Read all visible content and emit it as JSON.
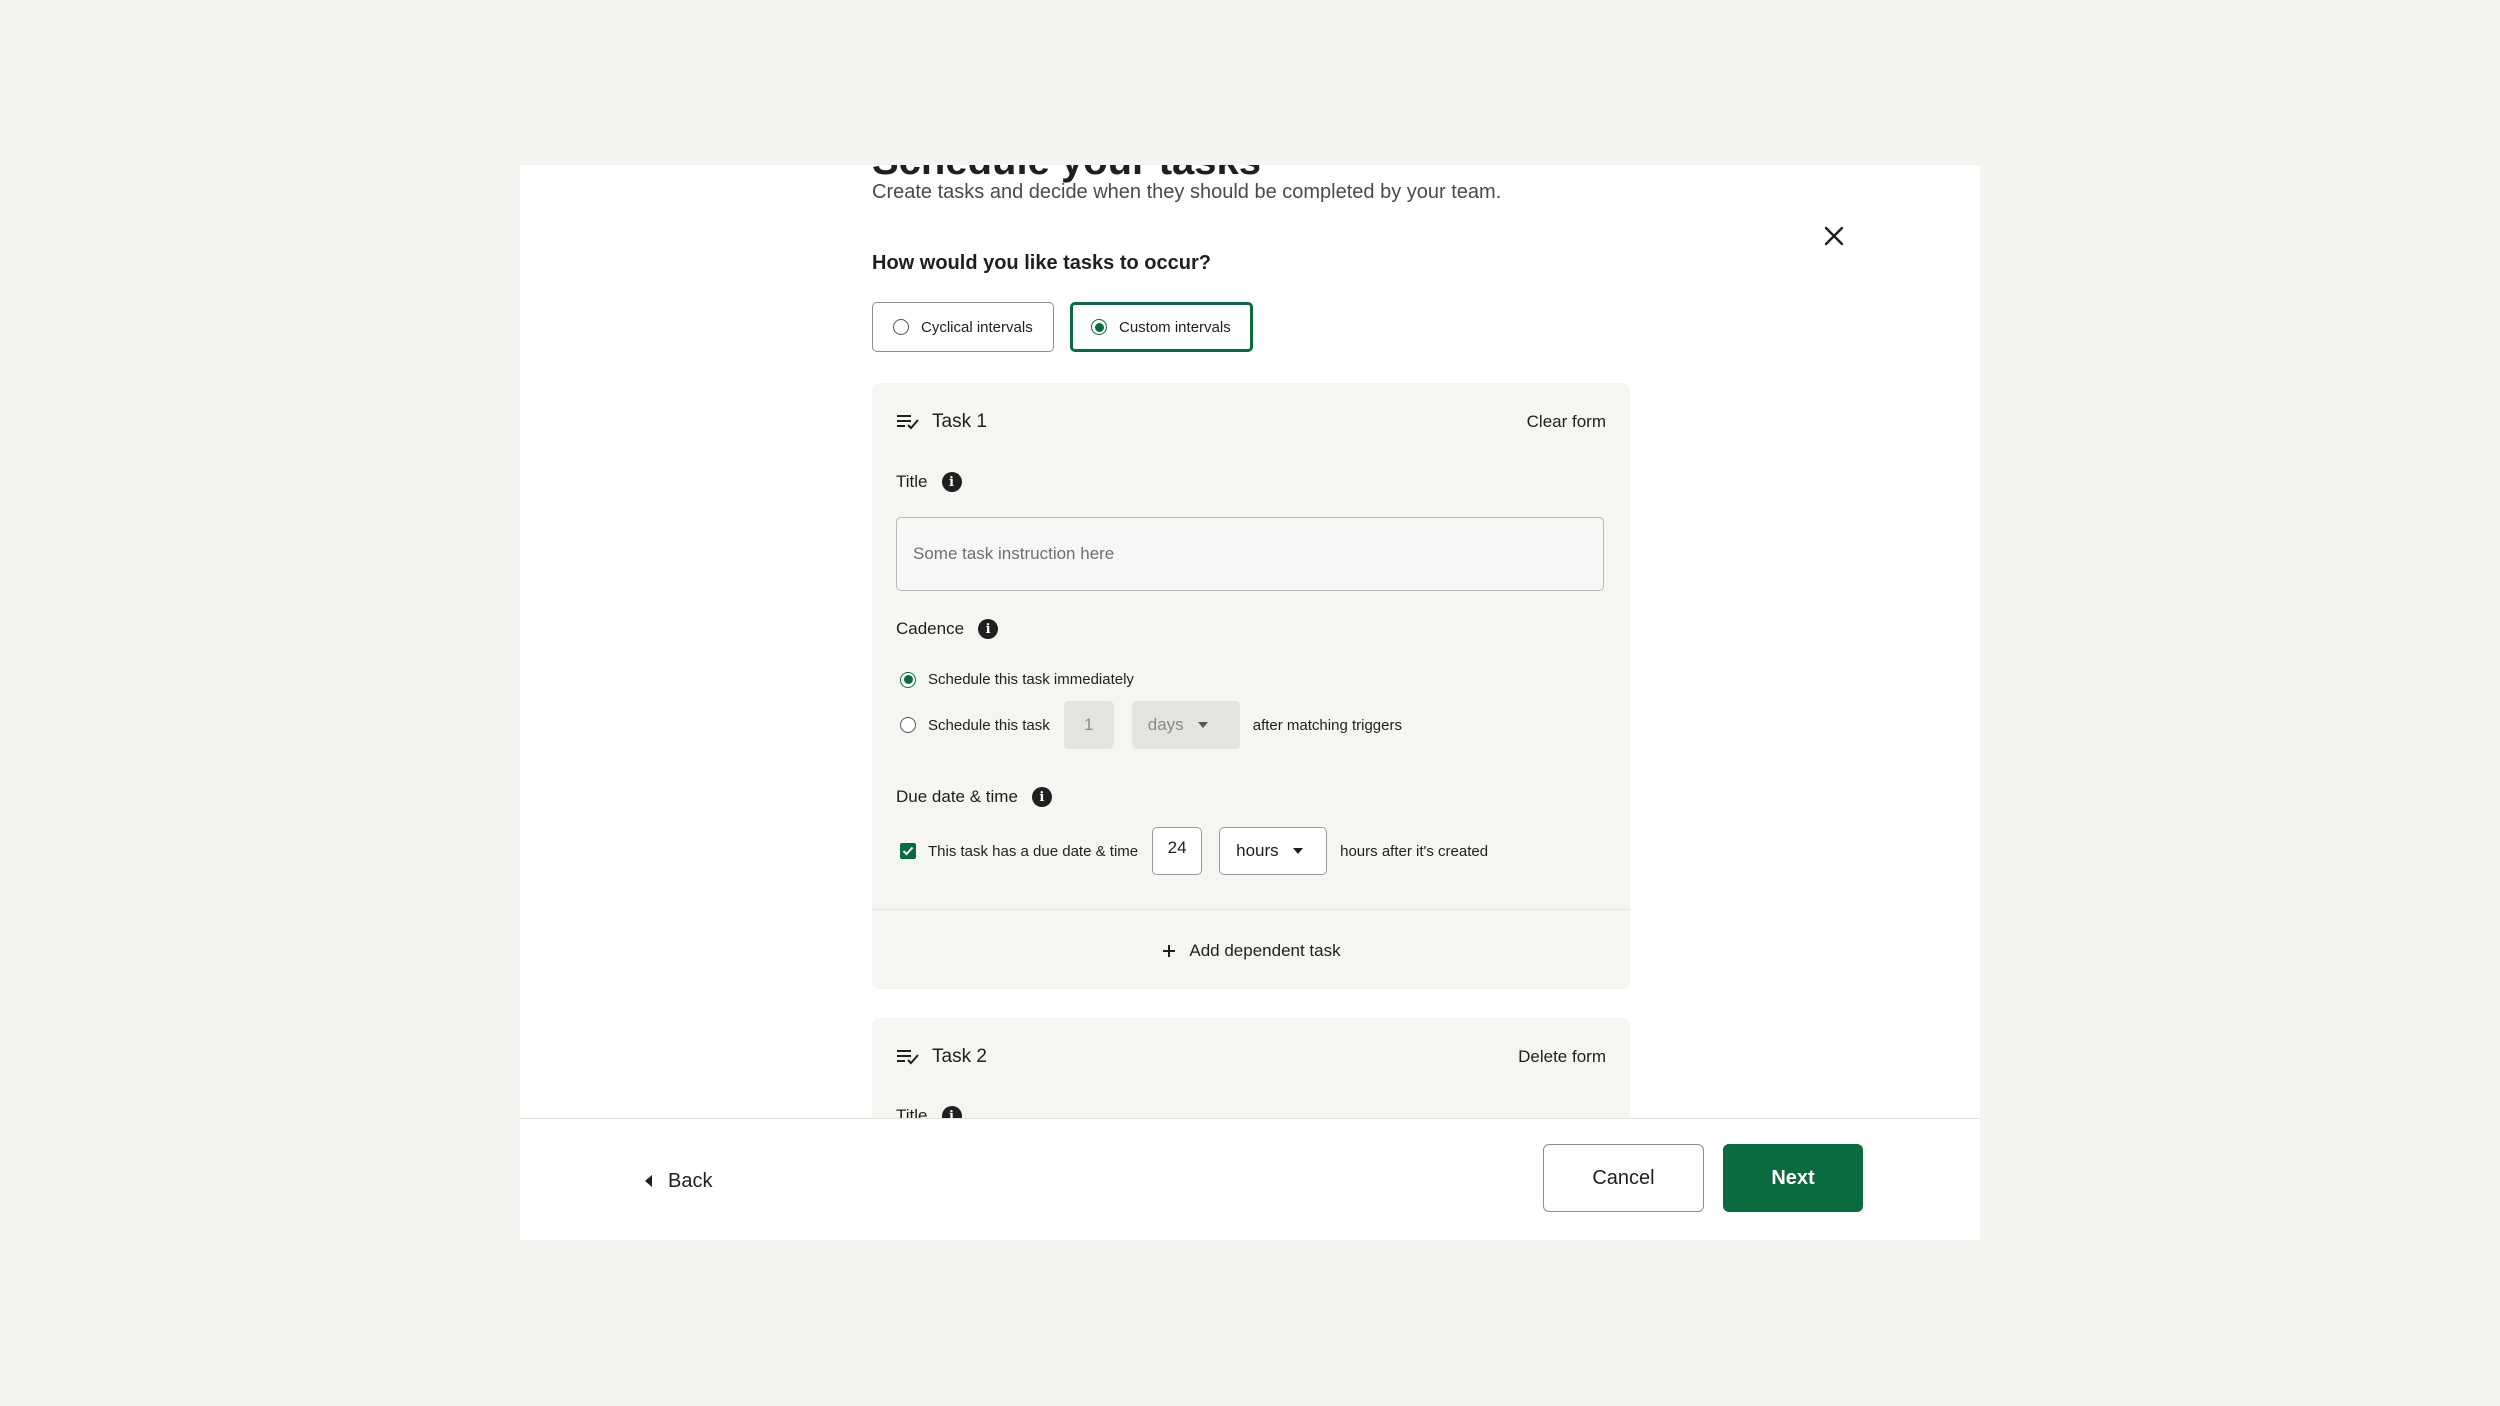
{
  "intro": {
    "title": "Schedule your tasks",
    "subtitle": "Create tasks and decide when they should be completed by your team."
  },
  "occurrence": {
    "question": "How would you like tasks to occur?",
    "options": [
      {
        "label": "Cyclical intervals",
        "selected": false
      },
      {
        "label": "Custom intervals",
        "selected": true
      }
    ]
  },
  "task1": {
    "title": "Task 1",
    "action": "Clear form",
    "title_label": "Title",
    "title_placeholder": "Some task instruction here",
    "cadence_label": "Cadence",
    "cadence_immediate": "Schedule this task immediately",
    "cadence_delayed": "Schedule this task",
    "delay_value": "1",
    "delay_unit": "days",
    "delay_suffix": "after matching triggers",
    "due_label": "Due date & time",
    "due_checkbox": "This task has a due date & time",
    "due_value": "24",
    "due_unit": "hours",
    "due_suffix": "hours after it's created",
    "add_dependent": "Add dependent task"
  },
  "task2": {
    "title": "Task 2",
    "action": "Delete form",
    "title_label": "Title"
  },
  "footer": {
    "back": "Back",
    "cancel": "Cancel",
    "next": "Next"
  },
  "colors": {
    "accent": "#0a6b3e",
    "background": "#f5f4f0",
    "card": "#f5f5f2"
  },
  "icons": [
    "close-icon",
    "task-list-icon",
    "info-icon",
    "plus-icon",
    "caret-down-icon",
    "check-icon",
    "back-arrow-icon"
  ]
}
